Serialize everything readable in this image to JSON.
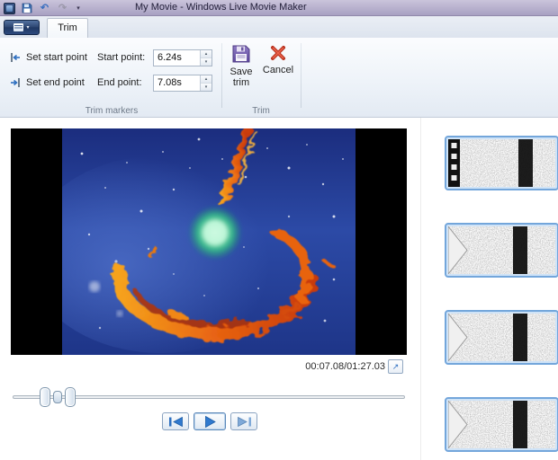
{
  "window": {
    "title": "My Movie - Windows Live Movie Maker"
  },
  "icons": {
    "undo": "↶",
    "redo": "↷",
    "qat_caret": "▾",
    "menu_caret": "▾",
    "spin_up": "▴",
    "spin_down": "▾",
    "popout": "↗"
  },
  "ribbon": {
    "tab_label": "Trim",
    "trim_markers": {
      "set_start_label": "Set start point",
      "set_end_label": "Set end point",
      "start_field_label": "Start point:",
      "start_value": "6.24s",
      "end_field_label": "End point:",
      "end_value": "7.08s",
      "group_label": "Trim markers"
    },
    "trim_group": {
      "save_trim_label": "Save trim",
      "cancel_label": "Cancel",
      "group_label": "Trim"
    }
  },
  "preview": {
    "time_display": "00:07.08/01:27.03"
  },
  "colors": {
    "titlebar": "#aea6c6",
    "accent_blue": "#2d6fc0",
    "thumbnail_selection": "#73a6db",
    "save_trim_icon": "#7a5ab5",
    "cancel_icon": "#c0392b"
  }
}
